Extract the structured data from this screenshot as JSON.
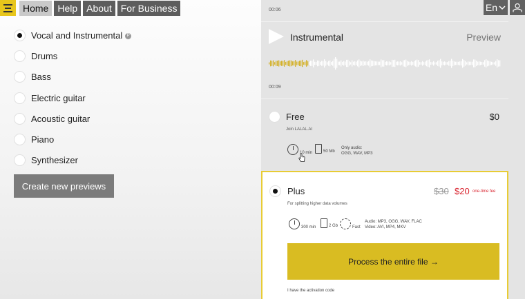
{
  "nav": {
    "items": [
      {
        "label": "Home",
        "active": true
      },
      {
        "label": "Help"
      },
      {
        "label": "About"
      },
      {
        "label": "For Business"
      }
    ]
  },
  "language": {
    "label": "En"
  },
  "instruments": {
    "items": [
      {
        "label": "Vocal and Instrumental",
        "badge": "P",
        "selected": true
      },
      {
        "label": "Drums",
        "selected": false
      },
      {
        "label": "Bass",
        "selected": false
      },
      {
        "label": "Electric guitar",
        "selected": false
      },
      {
        "label": "Acoustic guitar",
        "selected": false
      },
      {
        "label": "Piano",
        "selected": false
      },
      {
        "label": "Synthesizer",
        "selected": false
      }
    ],
    "create_label": "Create new previews"
  },
  "preview": {
    "top_time": "00:06",
    "title": "Instrumental",
    "preview_label": "Preview",
    "bottom_time": "00:09",
    "progress_fraction": 0.17
  },
  "plans": {
    "free": {
      "title": "Free",
      "price": "$0",
      "subtitle": "Join LALAL.AI",
      "duration": "10 min",
      "size": "50 Mb",
      "formats_line1": "Only audio:",
      "formats_line2": "OGG, WAV, MP3"
    },
    "plus": {
      "title": "Plus",
      "old_price": "$30",
      "new_price": "$20",
      "price_note": "one-time fee",
      "subtitle": "For splitting higher data volumes",
      "duration": "300 min",
      "size": "2 Gb",
      "speed": "Fast",
      "formats_line1": "Audio: MP3, OGG, WAV, FLAC",
      "formats_line2": "Video: AVI, MP4, MKV",
      "process_label": "Process the entire file →",
      "activation_label": "I have the activation code"
    }
  },
  "colors": {
    "accent": "#d9bc22",
    "sale_red": "#d9232e",
    "waveform_played": "#d4b22b"
  }
}
